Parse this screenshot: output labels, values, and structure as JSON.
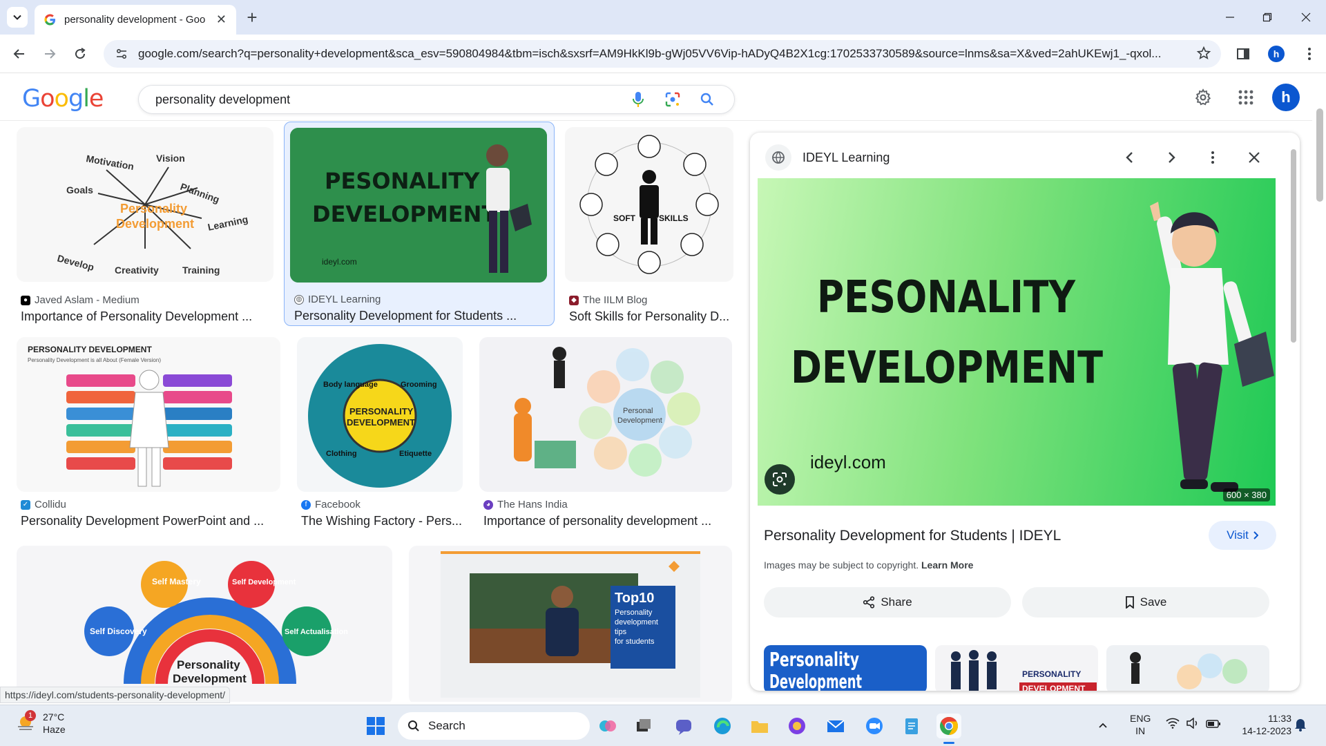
{
  "browser": {
    "tab_title": "personality development - Goo",
    "url": "google.com/search?q=personality+development&sca_esv=590804984&tbm=isch&sxsrf=AM9HkKl9b-gWj05VV6Vip-hADyQ4B2X1cg:1702533730589&source=lnms&sa=X&ved=2ahUKEwj1_-qxol...",
    "profile_initial": "h"
  },
  "google": {
    "query": "personality development",
    "avatar_initial": "h"
  },
  "results": [
    {
      "source": "Javed Aslam - Medium",
      "title": "Importance of Personality Development ..."
    },
    {
      "source": "IDEYL Learning",
      "title": "Personality Development for Students ..."
    },
    {
      "source": "The IILM Blog",
      "title": "Soft Skills for Personality D..."
    },
    {
      "source": "Collidu",
      "title": "Personality Development PowerPoint and ..."
    },
    {
      "source": "Facebook",
      "title": "The Wishing Factory - Pers..."
    },
    {
      "source": "The Hans India",
      "title": "Importance of personality development ..."
    }
  ],
  "thumbs": {
    "t1": {
      "motivation": "Motivation",
      "vision": "Vision",
      "goals": "Goals",
      "planning": "Planning",
      "center1": "Personality",
      "center2": "Development",
      "learning": "Learning",
      "develop": "Develop",
      "creativity": "Creativity",
      "training": "Training"
    },
    "t2": {
      "line1": "PESONALITY",
      "line2": "DEVELOPMENT",
      "site": "ideyl.com"
    },
    "t3": {
      "soft": "SOFT",
      "skills": "SKILLS"
    },
    "t4": {
      "heading": "PERSONALITY DEVELOPMENT",
      "sub": "Personality Development is all About (Female Version)"
    },
    "t5": {
      "center1": "PERSONALITY",
      "center2": "DEVELOPMENT",
      "body": "Body language",
      "grooming": "Grooming",
      "clothing": "Clothing",
      "etiquette": "Etiquette"
    },
    "t6": {
      "center1": "Personal",
      "center2": "Development"
    },
    "t7": {
      "self_mastery": "Self Mastery",
      "self_dev": "Self Development",
      "self_disc": "Self Discovery",
      "self_act": "Self Actualisation",
      "center1": "Personality",
      "center2": "Development"
    },
    "t8": {
      "top": "Top10",
      "l1": "Personality",
      "l2": "development",
      "l3": "tips",
      "l4": "for students"
    }
  },
  "panel": {
    "site": "IDEYL Learning",
    "image_line1": "PESONALITY",
    "image_line2": "DEVELOPMENT",
    "image_site": "ideyl.com",
    "dimensions": "600 × 380",
    "title": "Personality Development for Students | IDEYL",
    "visit": "Visit",
    "copyright": "Images may be subject to copyright.",
    "learn_more": "Learn More",
    "share": "Share",
    "save": "Save",
    "related1_line1": "Personality",
    "related1_line2": "Development",
    "related2_label1": "PERSONALITY",
    "related2_label2": "DEVELOPMENT"
  },
  "status_url": "https://ideyl.com/students-personality-development/",
  "taskbar": {
    "weather_temp": "27°C",
    "weather_desc": "Haze",
    "weather_badge": "1",
    "search": "Search",
    "lang1": "ENG",
    "lang2": "IN",
    "time": "11:33",
    "date": "14-12-2023"
  },
  "colors": {
    "google_blue": "#4285F4",
    "google_red": "#EA4335",
    "google_yellow": "#FBBC05",
    "google_green": "#34A853",
    "accent": "#0b57d0"
  }
}
